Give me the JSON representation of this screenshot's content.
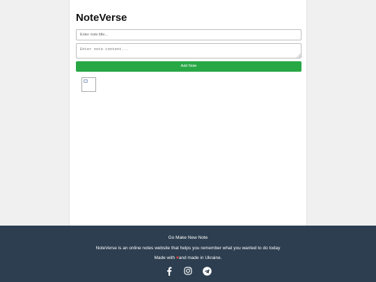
{
  "app": {
    "title": "NoteVerse"
  },
  "form": {
    "title_placeholder": "Enter note title...",
    "content_placeholder": "Enter note content...",
    "add_button_label": "Add Note"
  },
  "notes": {
    "image_icon": "broken-image-icon"
  },
  "footer": {
    "cta": "Go Make New Note",
    "about": "NoteVerse is an online notes website that helps you remember what you wanted to do today",
    "made_prefix": "Made with",
    "heart_icon": "heart-icon",
    "made_suffix": "and made in Ukraine.",
    "socials": [
      {
        "name": "facebook-icon"
      },
      {
        "name": "instagram-icon"
      },
      {
        "name": "telegram-icon"
      }
    ]
  },
  "colors": {
    "footer_bg": "#2c3e50",
    "add_button_bg": "#28a745",
    "heart": "#e74c3c"
  }
}
